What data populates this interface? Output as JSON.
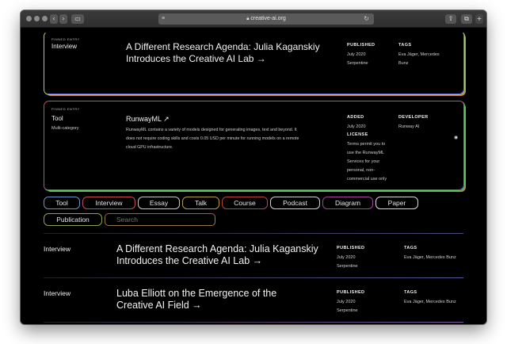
{
  "browser": {
    "url": "creative-ai.org",
    "back_label": "‹",
    "forward_label": "›"
  },
  "pinned": [
    {
      "badge": "PINNED ENTRY",
      "kind": "Interview",
      "sub_kind": "",
      "title": "A Different Research Agenda: Julia Kaganskiy Introduces the Creative AI Lab →",
      "meta1_label": "PUBLISHED",
      "meta1_value": [
        "July 2020",
        "Serpentine"
      ],
      "meta2_label": "TAGS",
      "meta2_value": [
        "Eva Jäger, Mercedes",
        "Bunz"
      ]
    },
    {
      "badge": "PINNED ENTRY",
      "kind": "Tool",
      "sub_kind": "Multi-category",
      "title": "RunwayML ↗",
      "description": "RunwayML contains a variety of models designed for generating images, text and beyond. It does not require coding skills and costs 0.05 USD per minute for running models on a remote cloud GPU infrastructure.",
      "meta1_label": "ADDED",
      "meta1_value": [
        "July 2020"
      ],
      "meta2_label": "DEVELOPER",
      "meta2_value": [
        "Runway AI"
      ],
      "meta3_label": "LICENSE",
      "meta3_value": [
        "Terms permit you to",
        "use the RunwayML",
        "Services for your",
        "personal, non-",
        "commercial use only"
      ],
      "eye_icon": "eye-icon"
    }
  ],
  "filters": [
    "Tool",
    "Interview",
    "Essay",
    "Talk",
    "Course",
    "Podcast",
    "Diagram",
    "Paper",
    "Publication"
  ],
  "search_placeholder": "Search",
  "entries": [
    {
      "kind": "Interview",
      "title": "A Different Research Agenda: Julia Kaganskiy Introduces the Creative AI Lab →",
      "meta1_label": "PUBLISHED",
      "meta1_value": [
        "July 2020",
        "Serpentine"
      ],
      "meta2_label": "TAGS",
      "meta2_value": [
        "Eva Jäger, Mercedes Bunz"
      ]
    },
    {
      "kind": "Interview",
      "title": "Luba Elliott on the Emergence of the Creative AI Field →",
      "meta1_label": "PUBLISHED",
      "meta1_value": [
        "July 2020",
        "Serpentine"
      ],
      "meta2_label": "TAGS",
      "meta2_value": [
        "Eva Jäger, Mercedes Bunz"
      ]
    }
  ]
}
